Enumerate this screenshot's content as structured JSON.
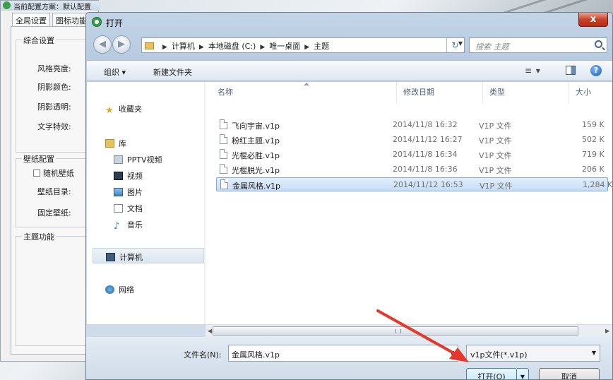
{
  "background_window": {
    "title": "当前配置方案：默认配置",
    "tabs": [
      "全局设置",
      "图标功能"
    ],
    "groups": [
      {
        "title": "综合设置",
        "rows": [
          "风格亮度:",
          "阴影颜色:",
          "阴影透明:",
          "文字特效:"
        ]
      },
      {
        "title": "壁纸配置",
        "checkbox_label": "随机壁纸",
        "rows": [
          "壁纸目录:",
          "固定壁纸:"
        ]
      },
      {
        "title": "主题功能"
      }
    ]
  },
  "dialog": {
    "title": "打开",
    "close_symbol": "x",
    "address_path": [
      "计算机",
      "本地磁盘 (C:)",
      "唯一桌面",
      "主题"
    ],
    "search_placeholder": "搜索 主题",
    "toolbar": {
      "organize": "组织 ▾",
      "new_folder": "新建文件夹",
      "view_icon": "≡ ▾"
    },
    "nav": {
      "favorites": "收藏夹",
      "library": "库",
      "library_items": [
        "PPTV视频",
        "视频",
        "图片",
        "文档",
        "音乐"
      ],
      "computer": "计算机",
      "network": "网络"
    },
    "columns": {
      "name": "名称",
      "date": "修改日期",
      "type": "类型",
      "size": "大小"
    },
    "files": [
      {
        "name": "飞向宇宙.v1p",
        "date": "2014/11/8 16:32",
        "type": "V1P 文件",
        "size": "159 K"
      },
      {
        "name": "粉红主题.v1p",
        "date": "2014/11/12 16:27",
        "type": "V1P 文件",
        "size": "502 K"
      },
      {
        "name": "光棍必胜.v1p",
        "date": "2014/11/8 16:34",
        "type": "V1P 文件",
        "size": "719 K"
      },
      {
        "name": "光棍脱光.v1p",
        "date": "2014/11/8 16:36",
        "type": "V1P 文件",
        "size": "206 K"
      },
      {
        "name": "金属风格.v1p",
        "date": "2014/11/12 16:53",
        "type": "V1P 文件",
        "size": "1,284 K"
      }
    ],
    "selected_file_index": 4,
    "filename_label": "文件名(N):",
    "filename_value": "金属风格.v1p",
    "filter_value": "v1p文件(*.v1p)",
    "open_button": "打开(O)",
    "cancel_button": "取消"
  },
  "colors": {
    "annotation_arrow": "#e5372b",
    "selection": "#c7ddf6"
  }
}
